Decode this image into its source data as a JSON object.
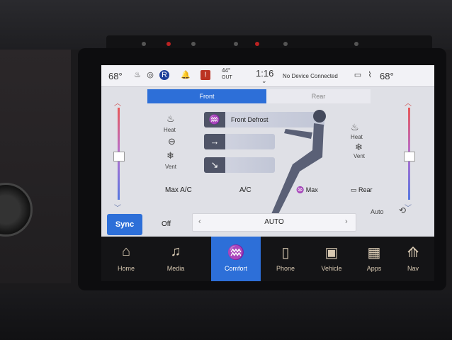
{
  "status": {
    "left_temp": "68°",
    "outside_temp": "44°",
    "outside_label": "OUT",
    "time": "1:16",
    "device": "No Device Connected",
    "right_temp": "68°",
    "icons": [
      "heated-seat-icon",
      "heated-wheel-icon",
      "user-icon",
      "bell-icon",
      "alert-icon",
      "phone-icon",
      "wifi-icon"
    ]
  },
  "tabs": {
    "front": "Front",
    "rear": "Rear"
  },
  "seat": {
    "left_heat": "Heat",
    "left_vent": "Vent",
    "right_heat": "Heat",
    "right_vent": "Vent"
  },
  "modes": {
    "defrost": "Front Defrost"
  },
  "controls": {
    "max_ac": "Max A/C",
    "ac": "A/C",
    "max": "Max",
    "rear": "Rear",
    "sync": "Sync",
    "off": "Off",
    "fan_value": "AUTO",
    "auto": "Auto"
  },
  "nav": [
    {
      "label": "Home"
    },
    {
      "label": "Media"
    },
    {
      "label": "Comfort"
    },
    {
      "label": "Phone"
    },
    {
      "label": "Vehicle"
    },
    {
      "label": "Apps"
    },
    {
      "label": "Nav"
    }
  ],
  "colors": {
    "accent": "#2d6fd8",
    "nav_text": "#d8c9b2"
  }
}
